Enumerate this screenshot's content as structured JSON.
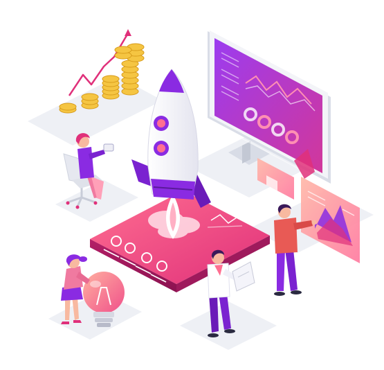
{
  "illustration": {
    "theme_colors": {
      "purple": "#8a2be2",
      "deep_purple": "#5a1a9a",
      "magenta": "#e0307a",
      "pink": "#ff6f91",
      "gold": "#f5c542",
      "light_gray": "#eceef3"
    },
    "icons": [
      "rocket-icon",
      "monitor-icon",
      "coin-stack-icon",
      "lightbulb-icon",
      "chart-icon",
      "euro-icon"
    ]
  }
}
